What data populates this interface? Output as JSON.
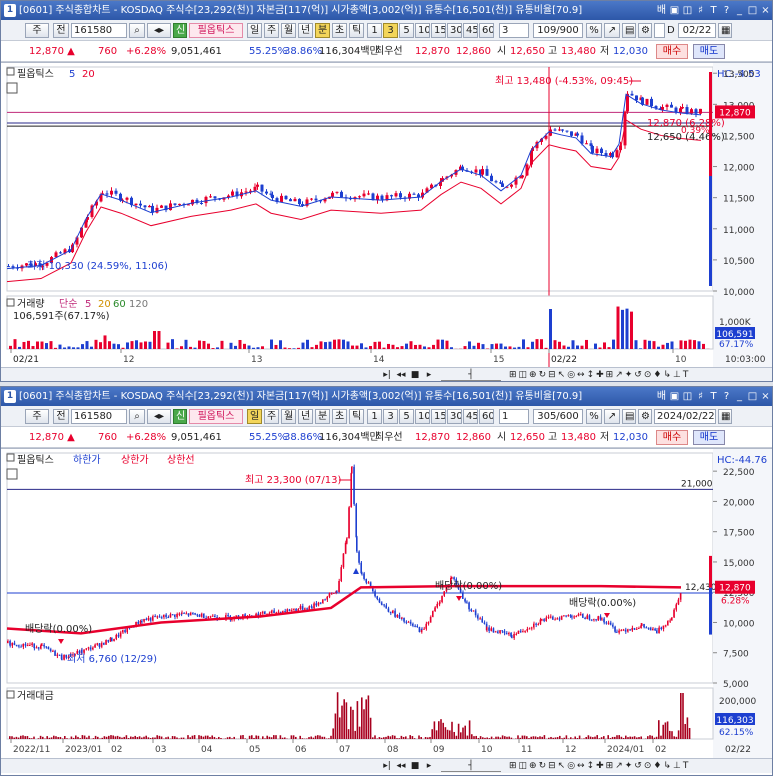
{
  "top": {
    "title": "[0601] 주식종합차트 - KOSDAQ 주식수[23,292(천)] 자본금[117(억)] 시가총액[3,002(억)] 유통수[16,501(천)] 유통비율[70.9]",
    "win_num": "1",
    "toolbar": {
      "type": "주",
      "all": "전",
      "code": "161580",
      "tag": "신",
      "indicator": "필옵틱스",
      "periods": [
        "일",
        "주",
        "월",
        "년",
        "분",
        "초",
        "틱"
      ],
      "intervals": [
        "1",
        "3",
        "5",
        "10",
        "15",
        "30",
        "45",
        "60"
      ],
      "interval_value": "3",
      "range": "109/900",
      "date": "02/22",
      "chk_label": "D"
    },
    "quote": {
      "price": "12,870",
      "change": "760",
      "rate": "+6.28%",
      "volume": "9,051,461",
      "v1": "55.25%",
      "v2": "38.86%",
      "amount": "116,304백만",
      "best_label": "최우선",
      "best_ask": "12,870",
      "best_bid": "12,860",
      "open_label": "시",
      "open": "12,650",
      "high_label": "고",
      "high": "13,480",
      "low_label": "저",
      "low": "12,030",
      "buy": "매수",
      "sell": "매도"
    },
    "legend": {
      "name": "필옵틱스",
      "ma5": "5",
      "ma20": "20",
      "hc": "HC:-4.53"
    },
    "annot": {
      "high": "최고 13,480 (-4.53%, 09:45)",
      "low": "최저 10,330 (24.59%, 11:06)",
      "line1": "12,870 (6.28%)",
      "line1b": "0.39%",
      "line2": "12,650 (4.46%)"
    },
    "yticks": [
      "13,500",
      "13,000",
      "12,500",
      "12,000",
      "11,500",
      "11,000",
      "10,500",
      "10,000"
    ],
    "price_box": "12,870",
    "vol": {
      "name": "거래량",
      "type": "단순",
      "p1": "5",
      "p2": "20",
      "p3": "60",
      "p4": "120",
      "info": "106,591주(67.17%)",
      "yticks": [
        "1,000K",
        "500K"
      ],
      "box": "106,591",
      "box_pct": "67.17%"
    },
    "xticks": [
      "02/21",
      "12",
      "13",
      "14",
      "15",
      "02/22",
      "10"
    ],
    "xtick_right": "10:03:00"
  },
  "bottom": {
    "title": "[0601] 주식종합차트 - KOSDAQ 주식수[23,292(천)] 자본금[117(억)] 시가총액[3,002(억)] 유통수[16,501(천)] 유통비율[70.9]",
    "win_num": "1",
    "toolbar": {
      "type": "주",
      "all": "전",
      "code": "161580",
      "tag": "신",
      "indicator": "필옵틱스",
      "periods": [
        "일",
        "주",
        "월",
        "년",
        "분",
        "초",
        "틱"
      ],
      "intervals": [
        "1",
        "3",
        "5",
        "10",
        "15",
        "30",
        "45",
        "60"
      ],
      "interval_value": "1",
      "range": "305/600",
      "date": "2024/02/22"
    },
    "quote": {
      "price": "12,870",
      "change": "760",
      "rate": "+6.28%",
      "volume": "9,051,461",
      "v1": "55.25%",
      "v2": "38.86%",
      "amount": "116,304백만",
      "best_label": "최우선",
      "best_ask": "12,870",
      "best_bid": "12,860",
      "open_label": "시",
      "open": "12,650",
      "high_label": "고",
      "high": "13,480",
      "low_label": "저",
      "low": "12,030",
      "buy": "매수",
      "sell": "매도"
    },
    "legend": {
      "name": "필옵틱스",
      "lower": "하한가",
      "upper": "상한가",
      "limit": "상한선",
      "hc": "HC:-44.76"
    },
    "annot": {
      "high": "최고 23,300 (07/13)",
      "low": "최저 6,760 (12/29)",
      "div1": "배당락(0.00%)",
      "div2": "배당락(0.00%)",
      "div3": "배당락(0.00%)",
      "line21": "21,000",
      "line12": "12,430"
    },
    "yticks": [
      "22,500",
      "20,000",
      "17,500",
      "15,000",
      "12,500",
      "10,000",
      "7,500",
      "5,000"
    ],
    "price_box": "12,870",
    "price_pct": "6.28%",
    "amt": {
      "name": "거래대금",
      "yticks": [
        "200,000",
        "100,000"
      ],
      "box": "116,303",
      "box_pct": "62.15%"
    },
    "xticks": [
      "2022/11",
      "2023/01",
      "02",
      "03",
      "04",
      "05",
      "06",
      "07",
      "08",
      "09",
      "10",
      "11",
      "12",
      "2024/01",
      "02"
    ],
    "xtick_right": "02/22"
  },
  "colors": {
    "up": "#e8002d",
    "down": "#1d3fd0",
    "ma5": "#1d3fd0",
    "ma20": "#e8002d"
  },
  "chart_data": [
    {
      "type": "candlestick",
      "title": "필옵틱스 3분봉",
      "x_range": [
        "02/21",
        "02/22 10:03"
      ],
      "ylim": [
        10000,
        13600
      ],
      "high": 13480,
      "low": 10330,
      "last": 12870,
      "series": [
        {
          "name": "5",
          "type": "line"
        },
        {
          "name": "20",
          "type": "line"
        }
      ]
    },
    {
      "type": "candlestick",
      "title": "필옵틱스 일봉",
      "x_range": [
        "2022/11",
        "2024/02/22"
      ],
      "ylim": [
        5000,
        24000
      ],
      "high": 23300,
      "low": 6760,
      "last": 12870
    }
  ]
}
